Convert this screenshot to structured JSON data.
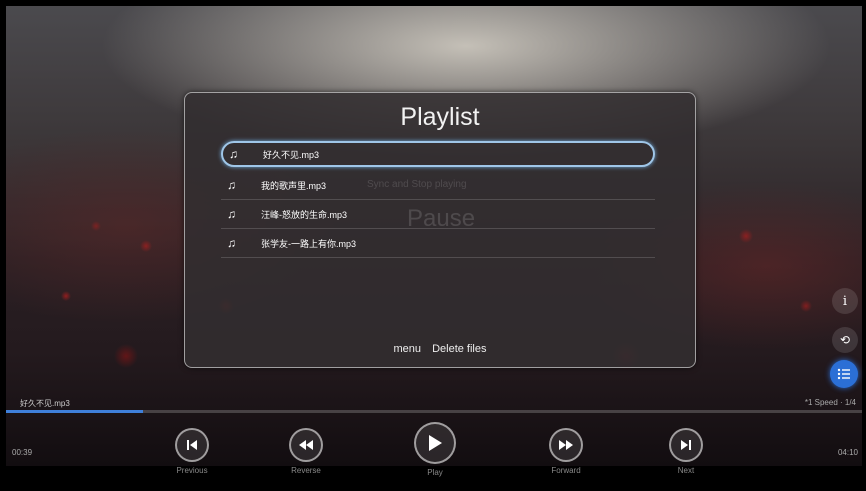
{
  "player": {
    "now_playing": "好久不见.mp3",
    "speed_info": "*1 Speed · 1/4",
    "time_elapsed": "00:39",
    "time_total": "04:10",
    "progress": 0.16
  },
  "playlist": {
    "title": "Playlist",
    "items": [
      {
        "label": "好久不见.mp3"
      },
      {
        "label": "我的歌声里.mp3"
      },
      {
        "label": "汪峰-怒放的生命.mp3"
      },
      {
        "label": "张学友-一路上有你.mp3"
      }
    ],
    "selected_index": 0,
    "menu_key": "menu",
    "menu_action": "Delete files"
  },
  "background_text": {
    "line": "Sync and Stop playing",
    "button": "Pause"
  },
  "controls": {
    "previous": "Previous",
    "reverse": "Reverse",
    "play": "Play",
    "forward": "Forward",
    "next": "Next"
  },
  "side_icons": [
    "info-icon",
    "repeat-icon",
    "playlist-icon"
  ],
  "colors": {
    "accent": "#2b6fd6",
    "selection": "#9fc6e8"
  }
}
